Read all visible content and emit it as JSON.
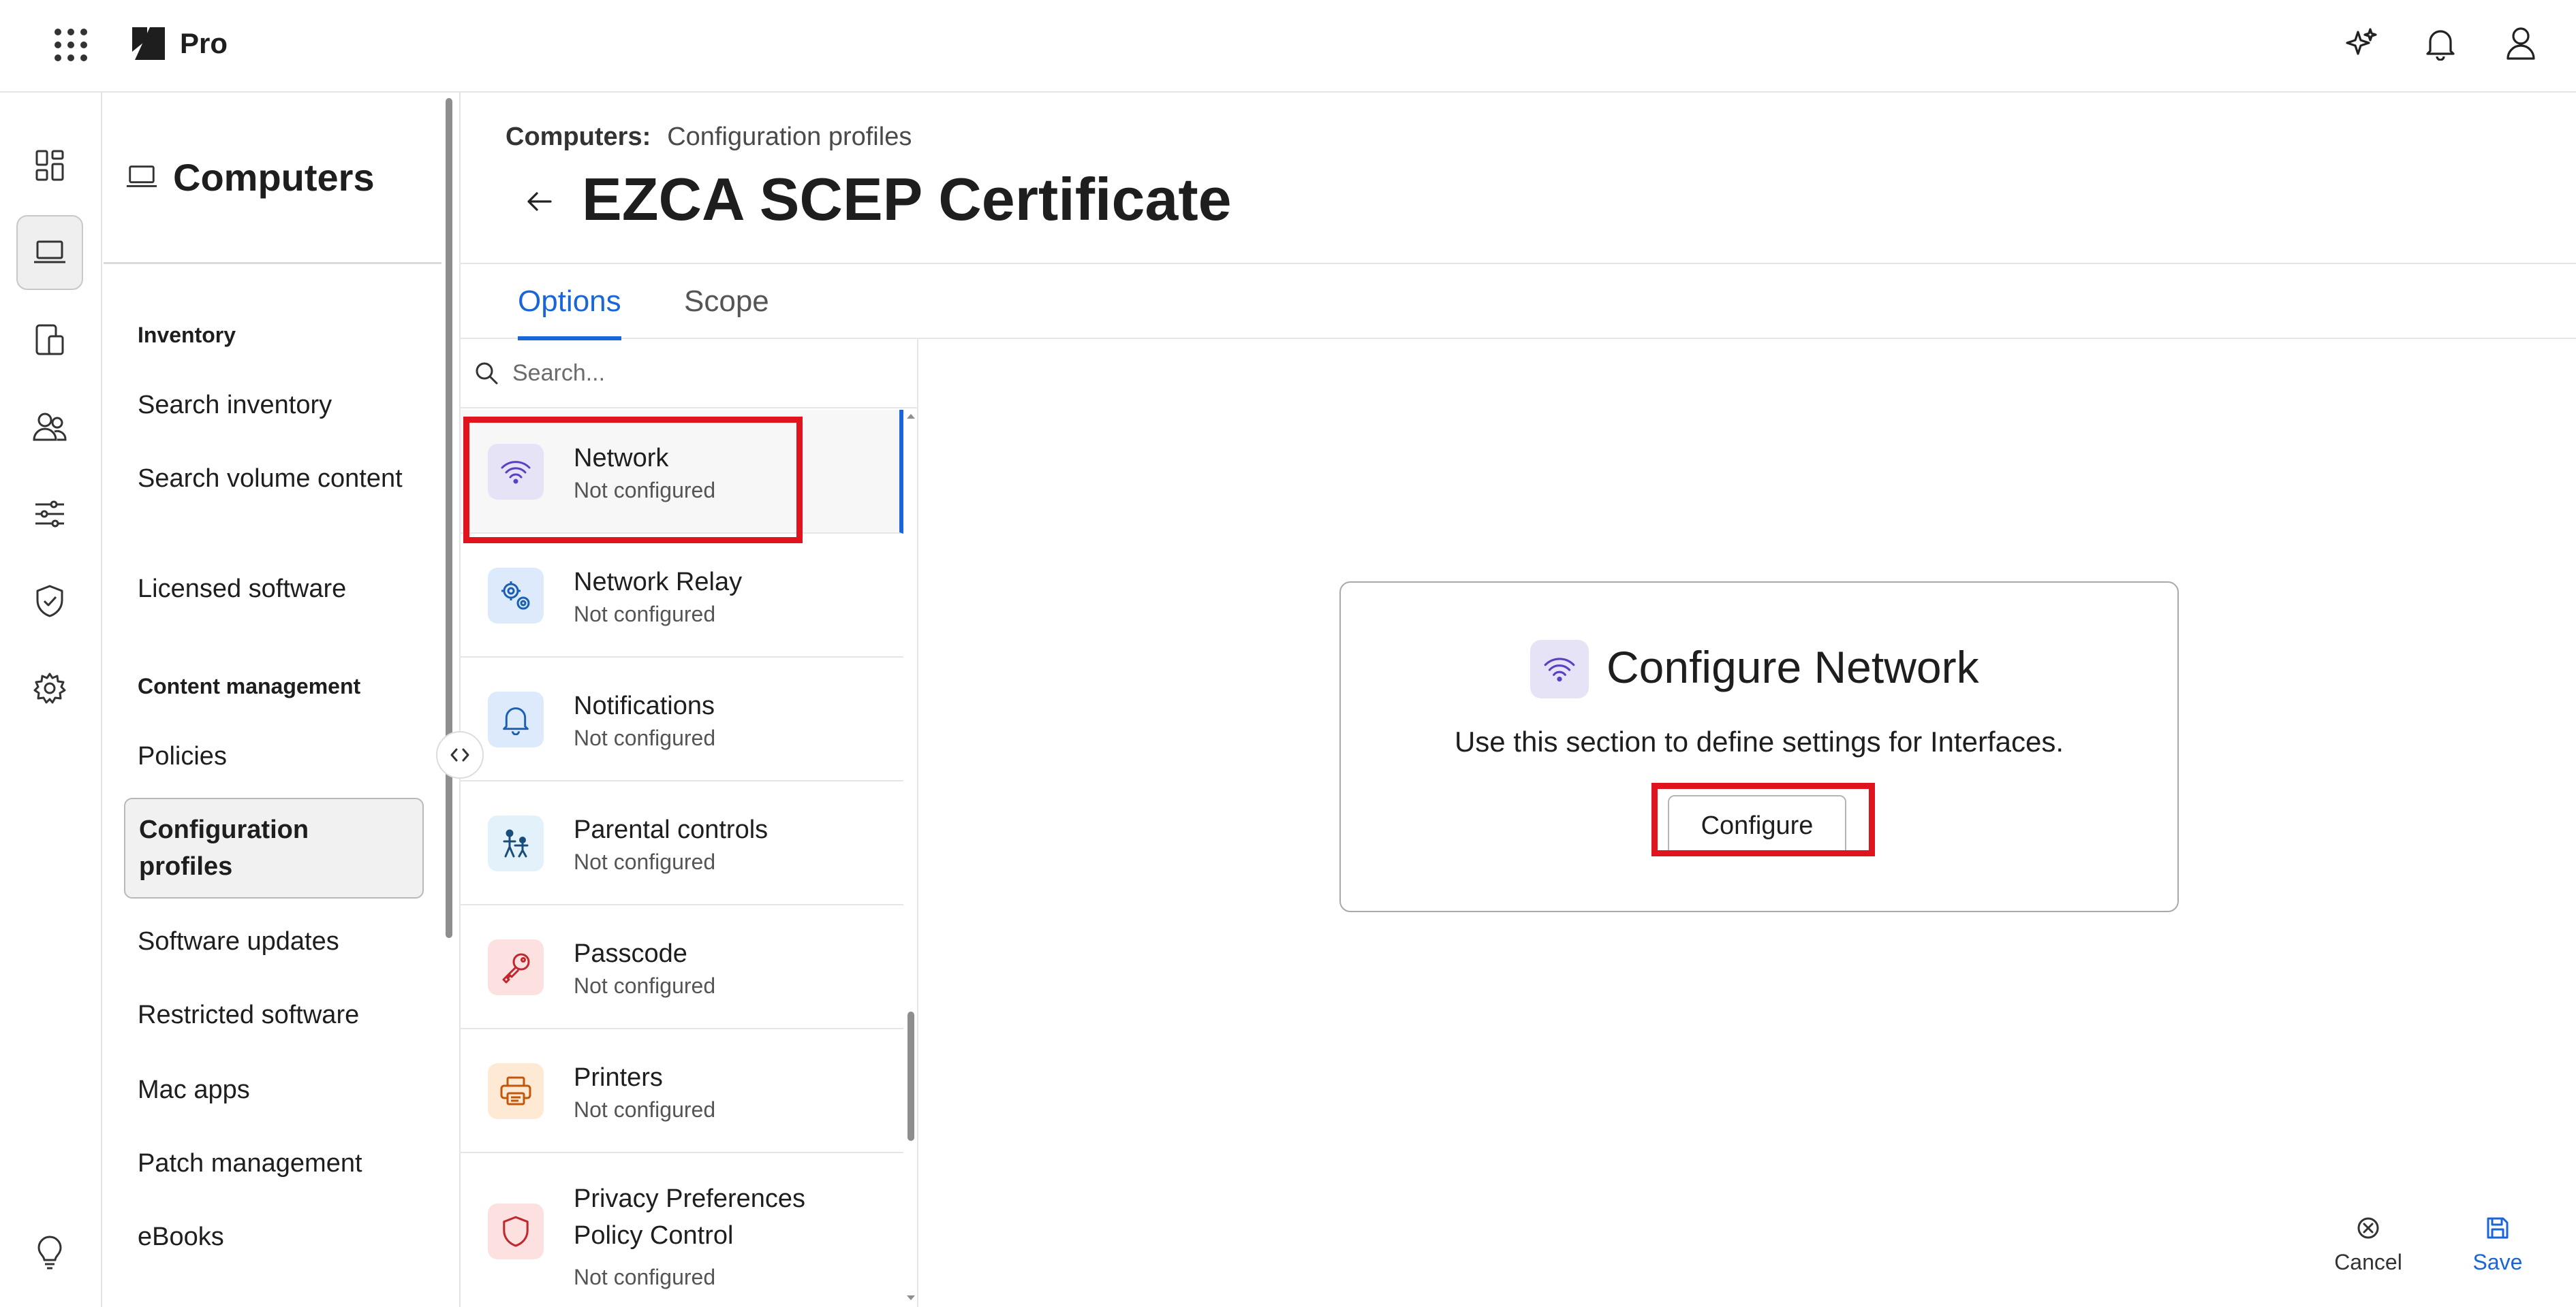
{
  "app": {
    "name": "Pro"
  },
  "header_icons": [
    "ai-sparkle-icon",
    "bell-icon",
    "user-icon"
  ],
  "rail": {
    "items": [
      "dashboard-icon",
      "computer-icon",
      "devices-icon",
      "users-icon",
      "settings-sliders-icon",
      "shield-check-icon",
      "gear-icon"
    ],
    "footer": "lightbulb-icon"
  },
  "nav": {
    "title": "Computers",
    "sections": [
      {
        "heading": "Inventory",
        "items": [
          "Search inventory",
          "Search volume content",
          "Licensed software"
        ]
      },
      {
        "heading": "Content management",
        "items": [
          "Policies",
          "Configuration profiles",
          "Software updates",
          "Restricted software",
          "Mac apps",
          "Patch management",
          "eBooks"
        ]
      }
    ],
    "active_item": "Configuration profiles"
  },
  "breadcrumb": {
    "root": "Computers",
    "separator": ":",
    "current": "Configuration profiles"
  },
  "page": {
    "title": "EZCA SCEP Certificate"
  },
  "tabs": [
    {
      "label": "Options",
      "active": true
    },
    {
      "label": "Scope",
      "active": false
    }
  ],
  "search": {
    "placeholder": "Search..."
  },
  "payloads": [
    {
      "name": "Network",
      "status": "Not configured",
      "icon": "wifi-icon",
      "color": "#5b3fc4",
      "bg": "#e6e3f7",
      "selected": true
    },
    {
      "name": "Network Relay",
      "status": "Not configured",
      "icon": "network-relay-gears-icon",
      "color": "#1a5fb4",
      "bg": "#dceafb"
    },
    {
      "name": "Notifications",
      "status": "Not configured",
      "icon": "bell-icon",
      "color": "#1a5fb4",
      "bg": "#dceafb"
    },
    {
      "name": "Parental controls",
      "status": "Not configured",
      "icon": "parent-child-icon",
      "color": "#1a4e7a",
      "bg": "#e3f1fb"
    },
    {
      "name": "Passcode",
      "status": "Not configured",
      "icon": "key-icon",
      "color": "#c0282d",
      "bg": "#fde1e1"
    },
    {
      "name": "Printers",
      "status": "Not configured",
      "icon": "printer-icon",
      "color": "#c2570c",
      "bg": "#fde9d4"
    },
    {
      "name": "Privacy Preferences Policy Control",
      "status": "Not configured",
      "icon": "privacy-shield-icon",
      "color": "#c0282d",
      "bg": "#fde1e1"
    }
  ],
  "config_card": {
    "title": "Configure Network",
    "description": "Use this section to define settings for Interfaces.",
    "button": "Configure"
  },
  "footer": {
    "cancel": "Cancel",
    "save": "Save"
  },
  "colors": {
    "accent": "#1a66d9",
    "highlight": "#e0141e"
  }
}
